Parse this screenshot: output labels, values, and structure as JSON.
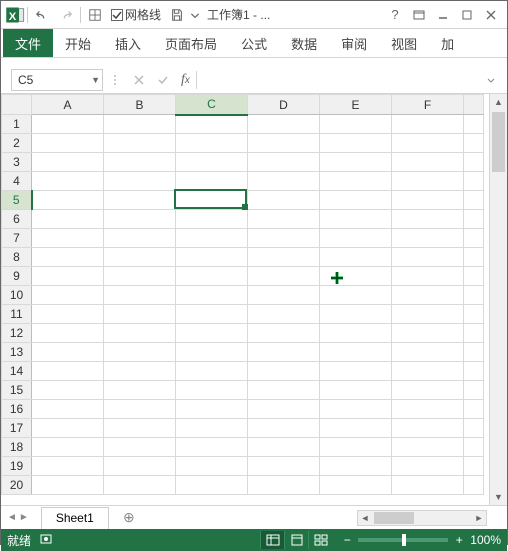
{
  "titlebar": {
    "gridlines_label": "网格线",
    "gridlines_checked": true,
    "workbook_title": "工作簿1 - ..."
  },
  "ribbon": {
    "tabs": [
      "文件",
      "开始",
      "插入",
      "页面布局",
      "公式",
      "数据",
      "审阅",
      "视图",
      "加"
    ],
    "active_index": 0
  },
  "formula_bar": {
    "namebox_value": "C5",
    "formula_value": ""
  },
  "grid": {
    "columns": [
      "A",
      "B",
      "C",
      "D",
      "E",
      "F"
    ],
    "row_count": 20,
    "selected_cell": {
      "col": "C",
      "row": 5
    }
  },
  "sheet_tabs": {
    "active": "Sheet1"
  },
  "statusbar": {
    "ready_label": "就绪",
    "zoom_label": "100%"
  }
}
